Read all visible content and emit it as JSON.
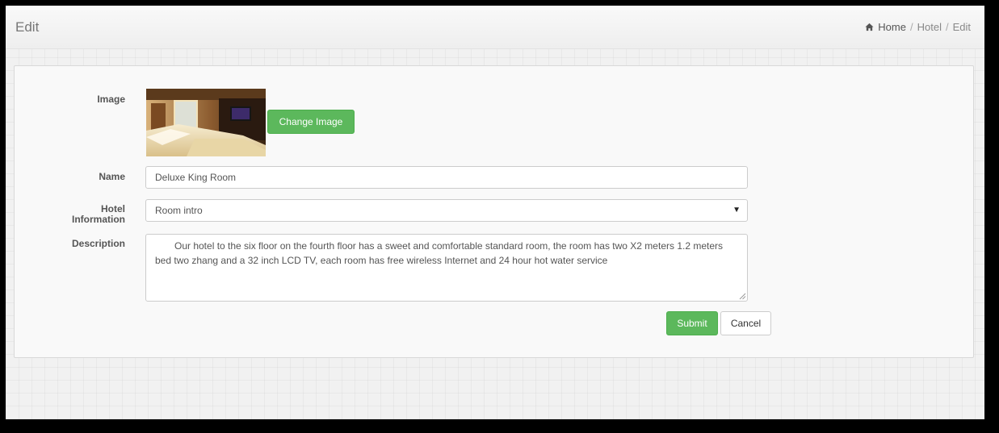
{
  "header": {
    "title": "Edit",
    "breadcrumb": [
      {
        "label": "Home"
      },
      {
        "label": "Hotel"
      },
      {
        "label": "Edit"
      }
    ]
  },
  "form": {
    "image": {
      "label": "Image",
      "change_button": "Change Image"
    },
    "name": {
      "label": "Name",
      "value": "Deluxe King Room"
    },
    "hotel_info": {
      "label_line1": "Hotel",
      "label_line2": "Information",
      "selected": "Room intro"
    },
    "description": {
      "label": "Description",
      "value": "Our hotel to the six floor on the fourth floor has a sweet and comfortable standard room, the room has two X2 meters 1.2 meters bed two zhang and a 32 inch LCD TV, each room has free wireless Internet and 24 hour hot water service"
    },
    "submit_label": "Submit",
    "cancel_label": "Cancel"
  },
  "colors": {
    "accent_green": "#5cb85c",
    "background": "#f1f1f1"
  },
  "icons": {
    "breadcrumb": "home-icon",
    "select": "caret-down-icon"
  }
}
